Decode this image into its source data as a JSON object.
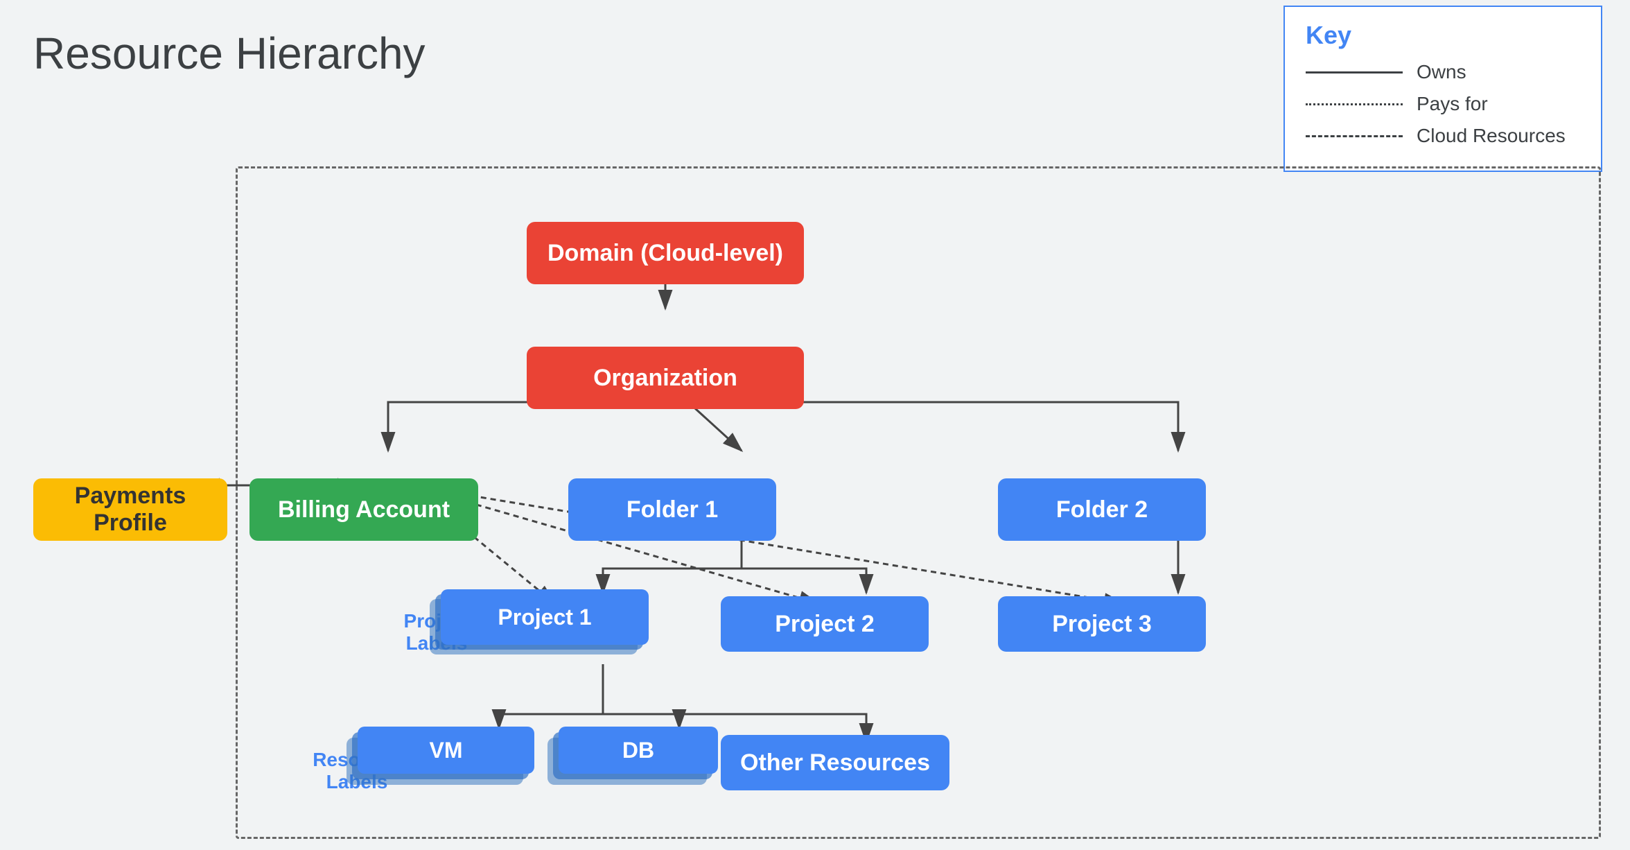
{
  "page": {
    "title": "Resource Hierarchy",
    "background": "#f1f3f4"
  },
  "key": {
    "title": "Key",
    "items": [
      {
        "line_type": "solid",
        "label": "Owns"
      },
      {
        "line_type": "dotted",
        "label": "Pays for"
      },
      {
        "line_type": "dashed",
        "label": "Cloud Resources"
      }
    ]
  },
  "nodes": {
    "domain": "Domain (Cloud-level)",
    "organization": "Organization",
    "billing_account": "Billing Account",
    "payments_profile": "Payments Profile",
    "folder1": "Folder 1",
    "folder2": "Folder 2",
    "project1": "Project 1",
    "project2": "Project 2",
    "project3": "Project 3",
    "vm": "VM",
    "db": "DB",
    "other_resources": "Other Resources",
    "project_labels": "Project\nLabels",
    "resource_labels": "Resource\nLabels"
  }
}
